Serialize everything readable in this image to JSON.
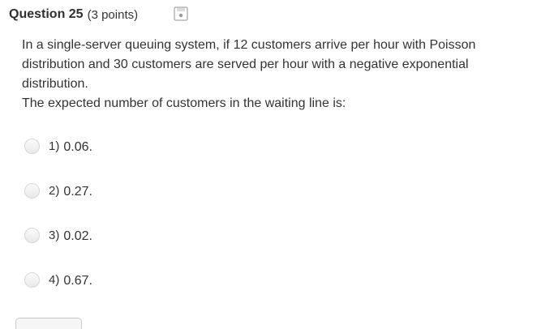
{
  "question": {
    "title": "Question 25",
    "points": "(3 points)",
    "save_icon": "save-icon",
    "text_lines": [
      "In a single-server queuing system, if 12 customers arrive per hour with Poisson distribution and 30 customers are served per hour with a negative exponential distribution.",
      "The expected number of customers in the waiting line is:"
    ]
  },
  "options": [
    {
      "number": "1)",
      "value": "0.06."
    },
    {
      "number": "2)",
      "value": "0.27."
    },
    {
      "number": "3)",
      "value": "0.02."
    },
    {
      "number": "4)",
      "value": "0.67."
    }
  ],
  "colors": {
    "text": "#333333",
    "radio_border": "#d7d7d7"
  }
}
